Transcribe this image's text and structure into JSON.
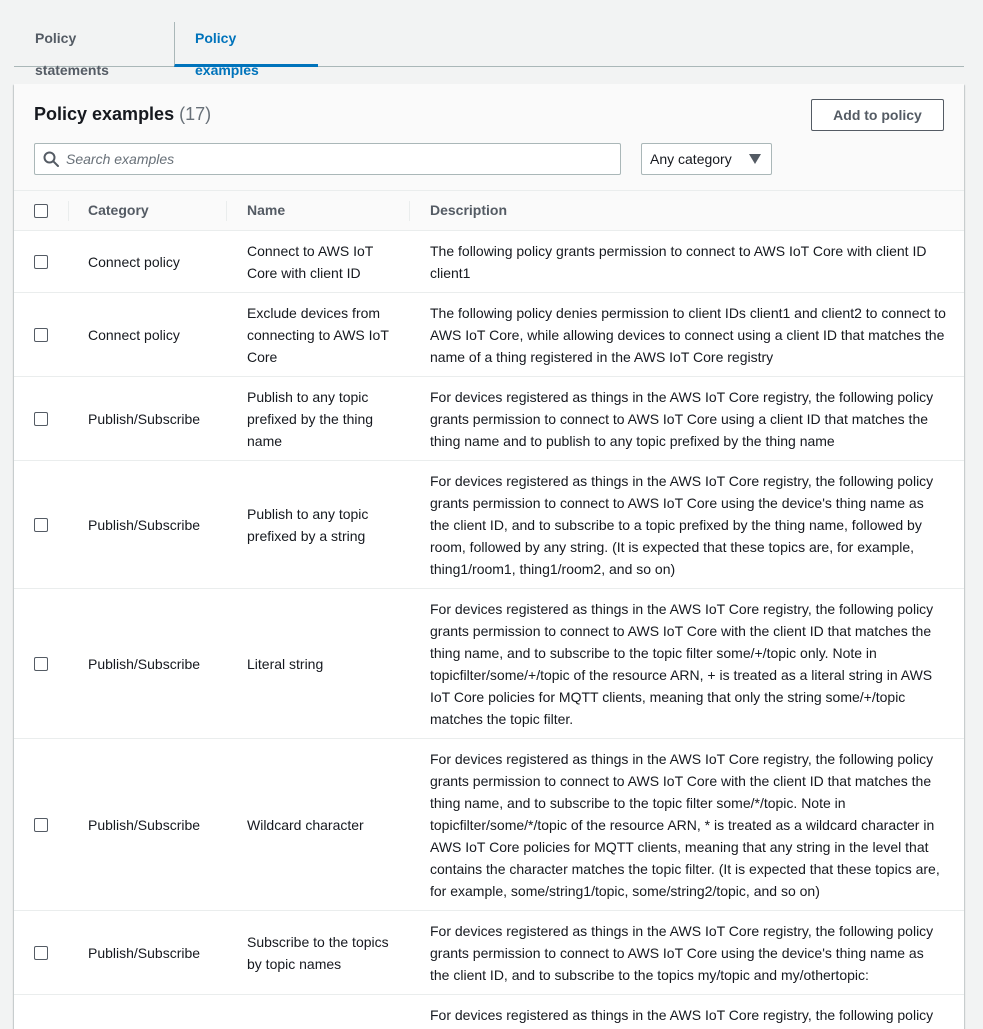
{
  "tabs": [
    {
      "label": "Policy statements",
      "active": false
    },
    {
      "label": "Policy examples",
      "active": true
    }
  ],
  "panel": {
    "title": "Policy examples",
    "count": "(17)",
    "add_button": "Add to policy",
    "search_placeholder": "Search examples",
    "category_select": "Any category"
  },
  "table": {
    "headers": {
      "category": "Category",
      "name": "Name",
      "description": "Description"
    },
    "rows": [
      {
        "category": "Connect policy",
        "name": "Connect to AWS IoT Core with client ID",
        "description": "The following policy grants permission to connect to AWS IoT Core with client ID client1"
      },
      {
        "category": "Connect policy",
        "name": "Exclude devices from connecting to AWS IoT Core",
        "description": "The following policy denies permission to client IDs client1 and client2 to connect to AWS IoT Core, while allowing devices to connect using a client ID that matches the name of a thing registered in the AWS IoT Core registry"
      },
      {
        "category": "Publish/Subscribe",
        "name": "Publish to any topic prefixed by the thing name",
        "description": "For devices registered as things in the AWS IoT Core registry, the following policy grants permission to connect to AWS IoT Core using a client ID that matches the thing name and to publish to any topic prefixed by the thing name"
      },
      {
        "category": "Publish/Subscribe",
        "name": "Publish to any topic prefixed by a string",
        "description": "For devices registered as things in the AWS IoT Core registry, the following policy grants permission to connect to AWS IoT Core using the device's thing name as the client ID, and to subscribe to a topic prefixed by the thing name, followed by room, followed by any string. (It is expected that these topics are, for example, thing1/room1, thing1/room2, and so on)"
      },
      {
        "category": "Publish/Subscribe",
        "name": "Literal string",
        "description": "For devices registered as things in the AWS IoT Core registry, the following policy grants permission to connect to AWS IoT Core with the client ID that matches the thing name, and to subscribe to the topic filter some/+/topic only. Note in topicfilter/some/+/topic of the resource ARN, + is treated as a literal string in AWS IoT Core policies for MQTT clients, meaning that only the string some/+/topic matches the topic filter."
      },
      {
        "category": "Publish/Subscribe",
        "name": "Wildcard character",
        "description": "For devices registered as things in the AWS IoT Core registry, the following policy grants permission to connect to AWS IoT Core with the client ID that matches the thing name, and to subscribe to the topic filter some/*/topic. Note in topicfilter/some/*/topic of the resource ARN, * is treated as a wildcard character in AWS IoT Core policies for MQTT clients, meaning that any string in the level that contains the character matches the topic filter. (It is expected that these topics are, for example, some/string1/topic, some/string2/topic, and so on)"
      },
      {
        "category": "Publish/Subscribe",
        "name": "Subscribe to the topics by topic names",
        "description": "For devices registered as things in the AWS IoT Core registry, the following policy grants permission to connect to AWS IoT Core using the device's thing name as the client ID, and to subscribe to the topics my/topic and my/othertopic:"
      },
      {
        "category": "",
        "name": "",
        "description": "For devices registered as things in the AWS IoT Core registry, the following policy"
      }
    ]
  }
}
